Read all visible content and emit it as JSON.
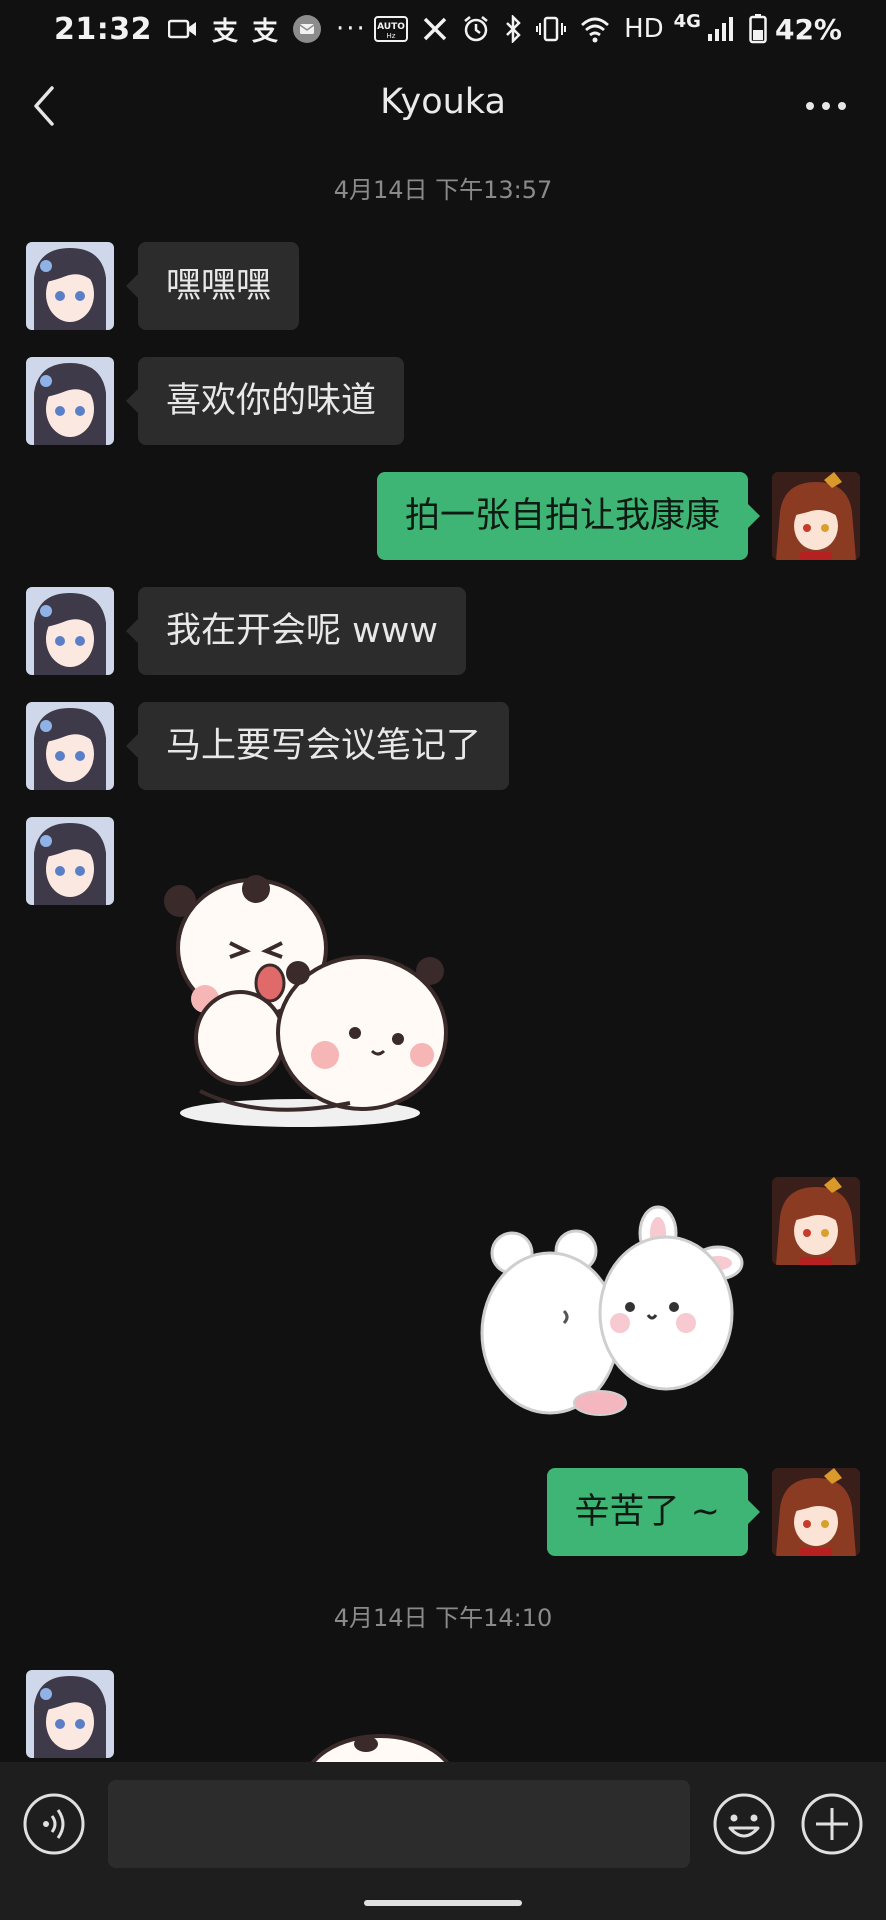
{
  "status_bar": {
    "time": "21:32",
    "network": "HD",
    "network_type": "4G",
    "battery": "42%",
    "auto_label": "AUTO",
    "hz_label": "Hz",
    "zhi_icon_glyph": "支",
    "dots": "···",
    "icons": [
      "video-icon",
      "alipay-icon",
      "alipay-icon",
      "message-icon",
      "auto-hz-icon",
      "x-icon",
      "alarm-icon",
      "bluetooth-icon",
      "vibrate-icon",
      "wifi-icon",
      "signal-icon",
      "battery-icon"
    ]
  },
  "header": {
    "title": "Kyouka",
    "back_icon": "chevron-left-icon",
    "more_icon": "more-dots-icon"
  },
  "messages": [
    {
      "type": "time",
      "text": "4月14日 下午13:57"
    },
    {
      "type": "text",
      "from": "them",
      "text": "嘿嘿嘿"
    },
    {
      "type": "text",
      "from": "them",
      "text": "喜欢你的味道"
    },
    {
      "type": "text",
      "from": "me",
      "text": "拍一张自拍让我康康"
    },
    {
      "type": "text",
      "from": "them",
      "text": "我在开会呢 www"
    },
    {
      "type": "text",
      "from": "them",
      "text": "马上要写会议笔记了"
    },
    {
      "type": "sticker",
      "from": "them",
      "sticker": "panda-bears-sticker"
    },
    {
      "type": "sticker",
      "from": "me",
      "sticker": "bunny-bears-sticker"
    },
    {
      "type": "text",
      "from": "me",
      "text": "辛苦了 ~"
    },
    {
      "type": "time",
      "text": "4月14日 下午14:10"
    },
    {
      "type": "sticker",
      "from": "them",
      "sticker": "panda-sticker-partial"
    }
  ],
  "input_bar": {
    "placeholder": "",
    "value": "",
    "voice_icon": "voice-icon",
    "emoji_icon": "emoji-icon",
    "plus_icon": "plus-icon"
  },
  "colors": {
    "background": "#111111",
    "incoming_bubble": "#2c2c2c",
    "outgoing_bubble": "#3eb575",
    "input_bar": "#1e1e1e"
  }
}
